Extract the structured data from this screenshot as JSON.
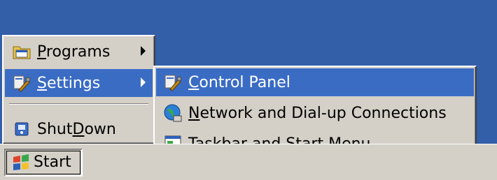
{
  "start_menu": {
    "items": [
      {
        "label_acc": "P",
        "label_rest": "rograms",
        "has_submenu": true,
        "highlighted": false
      },
      {
        "label_acc": "S",
        "label_rest": "ettings",
        "has_submenu": true,
        "highlighted": true
      },
      {
        "label_pre": "Shut",
        "label_acc": "D",
        "label_rest": "own",
        "has_submenu": false,
        "highlighted": false
      }
    ]
  },
  "settings_submenu": {
    "items": [
      {
        "label_acc": "C",
        "label_rest": "ontrol Panel",
        "highlighted": true
      },
      {
        "label_acc": "N",
        "label_rest": "etwork and Dial-up Connections",
        "highlighted": false
      },
      {
        "label_acc": "T",
        "label_rest": "askbar and Start Menu...",
        "highlighted": false
      }
    ]
  },
  "taskbar": {
    "start_label": "Start"
  },
  "colors": {
    "desktop": "#335ea8",
    "highlight": "#3a6cc4",
    "menu_face": "#d4d0c8"
  }
}
